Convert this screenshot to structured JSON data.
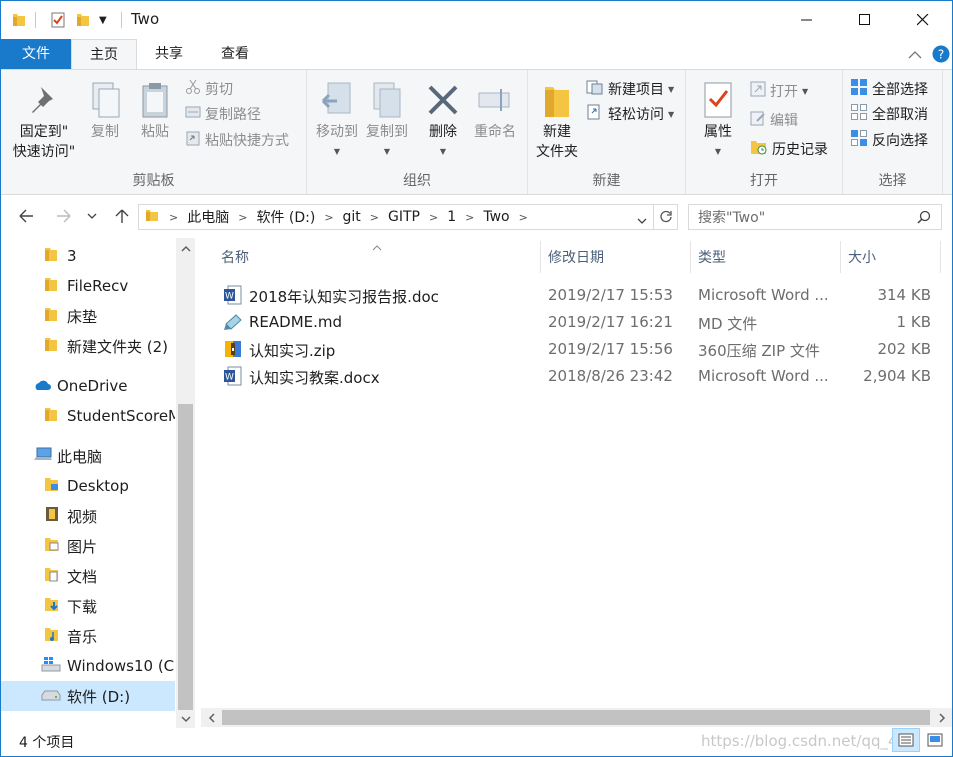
{
  "window": {
    "title": "Two",
    "minimize_glyph": "─",
    "maximize_glyph": "☐",
    "close_glyph": "✕"
  },
  "ribbon_tabs": {
    "file": "文件",
    "home": "主页",
    "share": "共享",
    "view": "查看"
  },
  "ribbon": {
    "clipboard": {
      "label": "剪贴板",
      "pin": "固定到\"\n快速访问\"",
      "pin_line1": "固定到\"",
      "pin_line2": "快速访问\"",
      "copy": "复制",
      "paste": "粘贴",
      "cut": "剪切",
      "copy_path": "复制路径",
      "paste_shortcut": "粘贴快捷方式"
    },
    "organize": {
      "label": "组织",
      "move_to": "移动到",
      "copy_to": "复制到",
      "delete": "删除",
      "rename": "重命名"
    },
    "new": {
      "label": "新建",
      "new_folder_line1": "新建",
      "new_folder_line2": "文件夹",
      "new_item": "新建项目",
      "easy_access": "轻松访问"
    },
    "open": {
      "label": "打开",
      "properties": "属性",
      "open": "打开",
      "edit": "编辑",
      "history": "历史记录"
    },
    "select": {
      "label": "选择",
      "select_all": "全部选择",
      "select_none": "全部取消",
      "invert": "反向选择"
    }
  },
  "address": {
    "crumbs": [
      "此电脑",
      "软件 (D:)",
      "git",
      "GITP",
      "1",
      "Two"
    ],
    "search_placeholder": "搜索\"Two\""
  },
  "nav_pane": {
    "items": [
      "3",
      "FileRecv",
      "床垫",
      "新建文件夹 (2)",
      "OneDrive",
      "StudentScoreM",
      "此电脑",
      "Desktop",
      "视频",
      "图片",
      "文档",
      "下载",
      "音乐",
      "Windows10 (C:",
      "软件 (D:)"
    ]
  },
  "columns": {
    "name": "名称",
    "date": "修改日期",
    "type": "类型",
    "size": "大小"
  },
  "files": [
    {
      "name": "2018年认知实习报告报.doc",
      "date": "2019/2/17 15:53",
      "type": "Microsoft Word ...",
      "size": "314 KB",
      "icon": "word-doc-icon"
    },
    {
      "name": "README.md",
      "date": "2019/2/17 16:21",
      "type": "MD 文件",
      "size": "1 KB",
      "icon": "md-file-icon"
    },
    {
      "name": "认知实习.zip",
      "date": "2019/2/17 15:56",
      "type": "360压缩 ZIP 文件",
      "size": "202 KB",
      "icon": "zip-archive-icon"
    },
    {
      "name": "认知实习教案.docx",
      "date": "2018/8/26 23:42",
      "type": "Microsoft Word ...",
      "size": "2,904 KB",
      "icon": "word-docx-icon"
    }
  ],
  "status": {
    "count": "4 个项目",
    "watermark": "https://blog.csdn.net/qq_41..."
  },
  "colors": {
    "accent": "#1979ca",
    "folder": "#f4c542",
    "selection": "#cce8ff"
  }
}
